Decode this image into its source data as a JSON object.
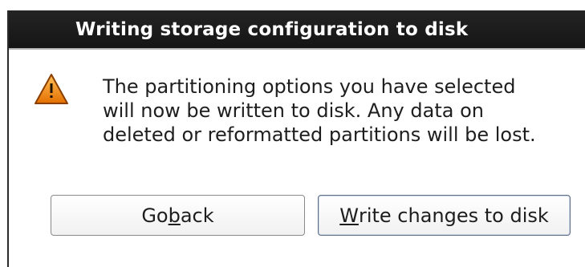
{
  "dialog": {
    "title": "Writing storage configuration to disk",
    "message_lines": [
      "The partitioning options you have selected",
      "will now be written to disk.  Any data on",
      "deleted or reformatted partitions will be lost."
    ],
    "icon": "warning-icon",
    "buttons": {
      "back": {
        "before": "Go ",
        "mnemonic": "b",
        "after": "ack"
      },
      "write": {
        "before": "",
        "mnemonic": "W",
        "after": "rite changes to disk"
      }
    }
  },
  "colors": {
    "titlebar_bg": "#1b1b1b",
    "warning_orange": "#f08a1a"
  }
}
